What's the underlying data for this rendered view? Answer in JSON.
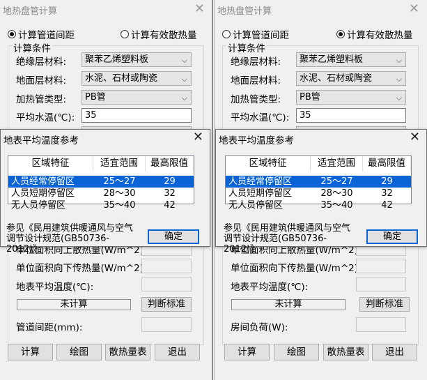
{
  "title": "地热盘管计算",
  "left": {
    "radio_spacing": "计算管道间距",
    "radio_heat": "计算有效散热量",
    "selected": "spacing",
    "group_title": "计算条件",
    "insulation_label": "绝缘层材料:",
    "insulation_value": "聚苯乙烯塑料板",
    "floor_label": "地面层材料:",
    "floor_value": "水泥、石材或陶瓷",
    "pipe_label": "加热管类型:",
    "pipe_value": "PB管",
    "water_temp_label": "平均水温(℃):",
    "water_temp_value": "35",
    "partial_label": "单位面积向上散热量(W/m^2):",
    "down_heat_label": "单位面积向下传热量(W/m^2):",
    "surface_temp_label": "地表平均温度(℃):",
    "status_text": "未计算",
    "judge_button": "判断标准",
    "result_label": "管道间距(mm):",
    "buttons": {
      "calc": "计算",
      "draw": "绘图",
      "table": "散热量表",
      "exit": "退出"
    }
  },
  "right": {
    "radio_spacing": "计算管道间距",
    "radio_heat": "计算有效散热量",
    "selected": "heat",
    "group_title": "计算条件",
    "insulation_label": "绝缘层材料:",
    "insulation_value": "聚苯乙烯塑料板",
    "floor_label": "地面层材料:",
    "floor_value": "水泥、石材或陶瓷",
    "pipe_label": "加热管类型:",
    "pipe_value": "PB管",
    "water_temp_label": "平均水温(℃):",
    "water_temp_value": "35",
    "partial_label": "单位面积向上散热量(W/m^2):",
    "down_heat_label": "单位面积向下传热量(W/m^2):",
    "surface_temp_label": "地表平均温度(℃):",
    "status_text": "未计算",
    "judge_button": "判断标准",
    "result_label": "房间负荷(W):",
    "buttons": {
      "calc": "计算",
      "draw": "绘图",
      "table": "散热量表",
      "exit": "退出"
    }
  },
  "dialog": {
    "title": "地表平均温度参考",
    "columns": [
      "区域特征",
      "适宜范围",
      "最高限值"
    ],
    "rows": [
      {
        "zone": "人员经常停留区",
        "range": "25～27",
        "max": "29"
      },
      {
        "zone": "人员短期停留区",
        "range": "28～30",
        "max": "32"
      },
      {
        "zone": "无人员停留区",
        "range": "35～40",
        "max": "42"
      }
    ],
    "selected_row": 0,
    "note": "参见《民用建筑供暖通风与空气调节设计规范(GB50736-2012)》",
    "ok_button": "确定"
  },
  "colors": {
    "selection": "#0a64d6",
    "title_gray": "#8a8a8a"
  }
}
